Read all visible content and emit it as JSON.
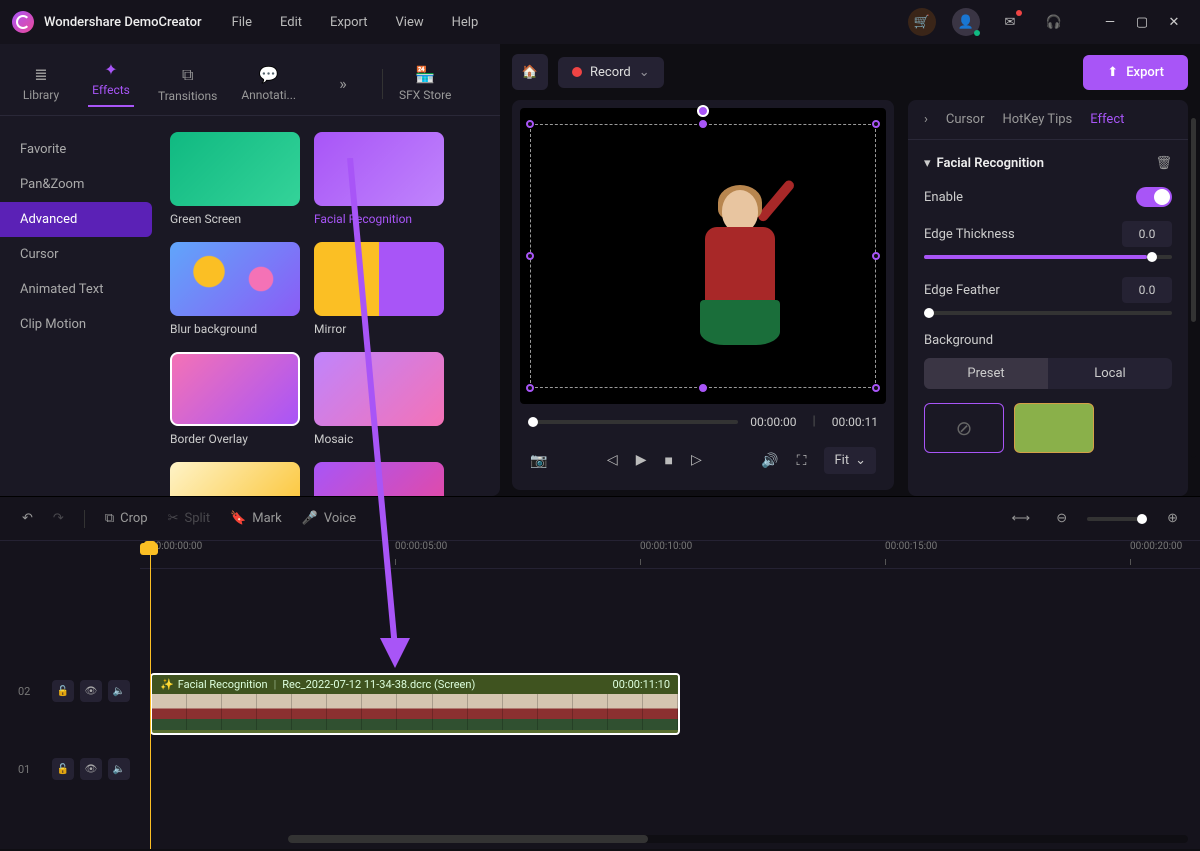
{
  "app_title": "Wondershare DemoCreator",
  "menu": [
    "File",
    "Edit",
    "Export",
    "View",
    "Help"
  ],
  "tabs": {
    "library": "Library",
    "effects": "Effects",
    "transitions": "Transitions",
    "annotations": "Annotati...",
    "sfx": "SFX Store"
  },
  "categories": [
    "Favorite",
    "Pan&Zoom",
    "Advanced",
    "Cursor",
    "Animated Text",
    "Clip Motion"
  ],
  "effects": [
    {
      "name": "Green Screen"
    },
    {
      "name": "Facial Recognition"
    },
    {
      "name": "Blur background"
    },
    {
      "name": "Mirror"
    },
    {
      "name": "Border Overlay"
    },
    {
      "name": "Mosaic"
    }
  ],
  "record_label": "Record",
  "export_label": "Export",
  "preview": {
    "current": "00:00:00",
    "total": "00:00:11",
    "fit": "Fit"
  },
  "panel_tabs": {
    "cursor": "Cursor",
    "hotkey": "HotKey Tips",
    "effect": "Effect"
  },
  "effect_panel": {
    "title": "Facial Recognition",
    "enable": "Enable",
    "edge_thickness": "Edge Thickness",
    "edge_thickness_val": "0.0",
    "edge_feather": "Edge Feather",
    "edge_feather_val": "0.0",
    "background": "Background",
    "preset": "Preset",
    "local": "Local"
  },
  "timeline_tools": {
    "crop": "Crop",
    "split": "Split",
    "mark": "Mark",
    "voice": "Voice"
  },
  "ruler": [
    "00:00:00:00",
    "00:00:05:00",
    "00:00:10:00",
    "00:00:15:00",
    "00:00:20:00"
  ],
  "tracks": {
    "t02": "02",
    "t01": "01"
  },
  "clip": {
    "effect": "Facial Recognition",
    "file": "Rec_2022-07-12 11-34-38.dcrc (Screen)",
    "duration": "00:00:11:10"
  }
}
